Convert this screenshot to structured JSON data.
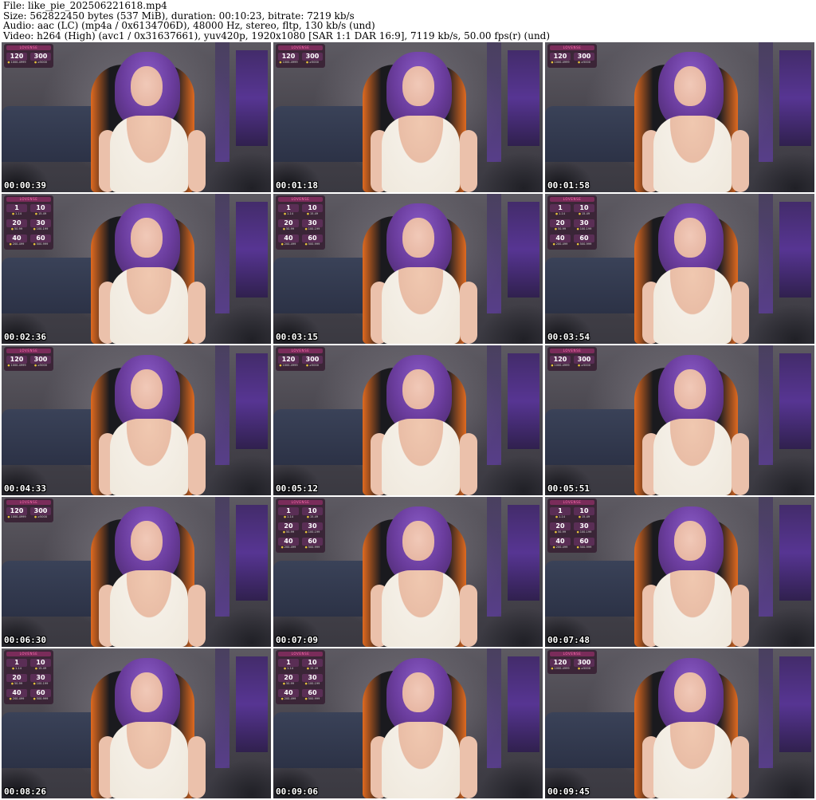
{
  "header": {
    "file": "File: like_pie_202506221618.mp4",
    "size": "Size: 562822450 bytes (537 MiB), duration: 00:10:23, bitrate: 7219 kb/s",
    "audio": "Audio: aac (LC) (mp4a / 0x6134706D), 48000 Hz, stereo, fltp, 130 kb/s (und)",
    "video": "Video: h264 (High) (avc1 / 0x31637661), yuv420p, 1920x1080 [SAR 1:1 DAR 16:9], 7119 kb/s, 50.00 fps(r) (und)"
  },
  "overlay_title": "LOVENSE",
  "tiers_small": [
    {
      "value": "120",
      "range": "1000-4999"
    },
    {
      "value": "300",
      "range": "≥5000"
    }
  ],
  "tiers_full": [
    {
      "value": "1",
      "range": "1-14"
    },
    {
      "value": "10",
      "range": "15-49"
    },
    {
      "value": "20",
      "range": "50-99"
    },
    {
      "value": "30",
      "range": "100-199"
    },
    {
      "value": "40",
      "range": "200-499"
    },
    {
      "value": "60",
      "range": "500-999"
    }
  ],
  "thumbs": [
    {
      "time": "00:00:39",
      "overlay": "small"
    },
    {
      "time": "00:01:18",
      "overlay": "small"
    },
    {
      "time": "00:01:58",
      "overlay": "small"
    },
    {
      "time": "00:02:36",
      "overlay": "full"
    },
    {
      "time": "00:03:15",
      "overlay": "full"
    },
    {
      "time": "00:03:54",
      "overlay": "full"
    },
    {
      "time": "00:04:33",
      "overlay": "small"
    },
    {
      "time": "00:05:12",
      "overlay": "small"
    },
    {
      "time": "00:05:51",
      "overlay": "small"
    },
    {
      "time": "00:06:30",
      "overlay": "small"
    },
    {
      "time": "00:07:09",
      "overlay": "full"
    },
    {
      "time": "00:07:48",
      "overlay": "full"
    },
    {
      "time": "00:08:26",
      "overlay": "full"
    },
    {
      "time": "00:09:06",
      "overlay": "full"
    },
    {
      "time": "00:09:45",
      "overlay": "small"
    }
  ]
}
